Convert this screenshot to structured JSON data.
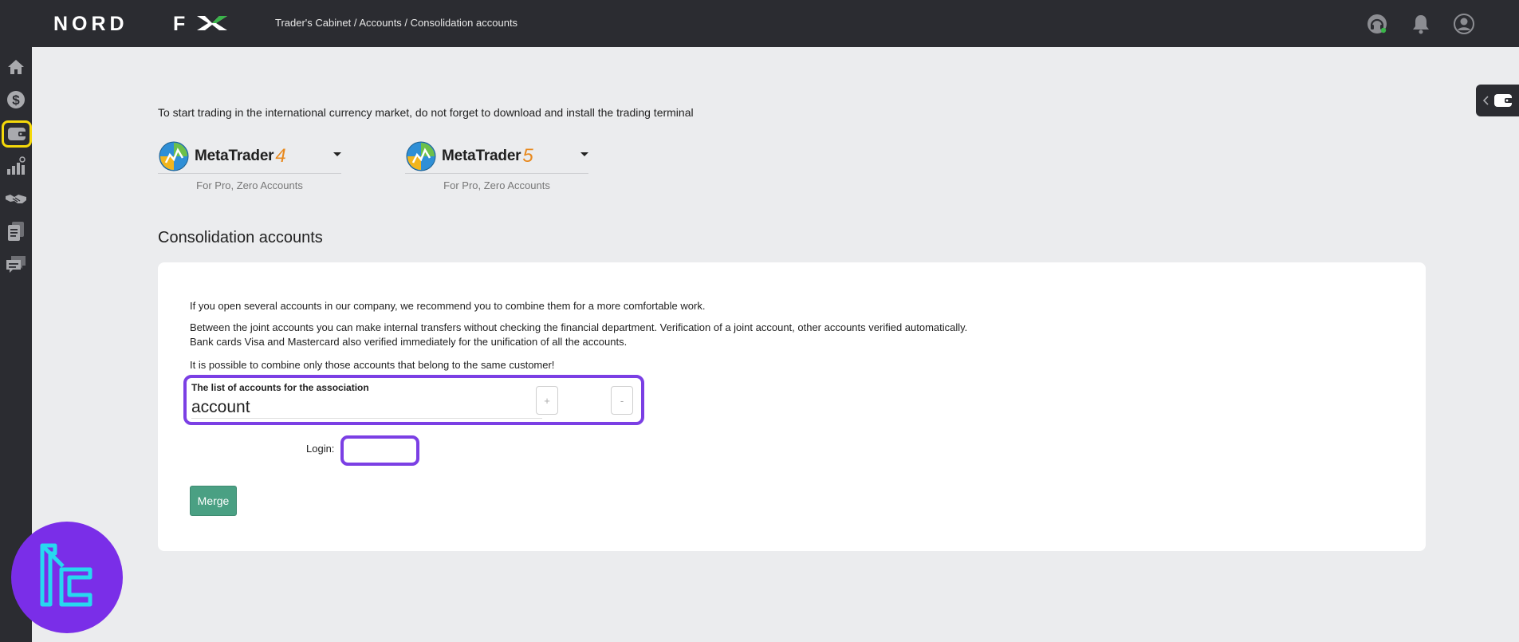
{
  "header": {
    "logo_text": "NORD FX",
    "breadcrumb": "Trader's Cabinet / Accounts / Consolidation accounts",
    "icons": [
      "headset-icon",
      "bell-icon",
      "user-icon"
    ]
  },
  "sidebar": {
    "items": [
      {
        "icon": "home-icon"
      },
      {
        "icon": "dollar-icon"
      },
      {
        "icon": "wallet-icon",
        "active": true
      },
      {
        "icon": "chart-icon"
      },
      {
        "icon": "handshake-icon"
      },
      {
        "icon": "documents-icon"
      },
      {
        "icon": "chat-icon"
      }
    ]
  },
  "wallet_panel": {
    "icon": "wallet-icon",
    "toggle_icon": "chevron-left-icon"
  },
  "main": {
    "intro": "To start trading in the international currency market, do not forget to download and install the trading terminal",
    "terminals": [
      {
        "name": "MetaTrader",
        "version": "4",
        "subtitle": "For Pro, Zero Accounts"
      },
      {
        "name": "MetaTrader",
        "version": "5",
        "subtitle": "For Pro, Zero Accounts"
      }
    ],
    "section_title": "Consolidation accounts",
    "paragraphs": {
      "p1": "If you open several accounts in our company, we recommend you to combine them for a more comfortable work.",
      "p2a": "Between the joint accounts you can make internal transfers without checking the financial department. Verification of a joint account, other accounts verified automatically.",
      "p2b": "Bank cards Visa and Mastercard also verified immediately for the unification of all the accounts.",
      "p3": "It is possible to combine only those accounts that belong to the same customer!"
    },
    "association": {
      "label": "The list of accounts for the association",
      "value": "account",
      "add_label": "+",
      "remove_label": "-"
    },
    "login": {
      "label": "Login:",
      "value": ""
    },
    "merge_label": "Merge"
  },
  "colors": {
    "topbar": "#2b2c31",
    "highlight": "#7b3fe4",
    "active_sidebar": "#f5d90a",
    "merge_button": "#4aa083",
    "mt_version": "#e8891e"
  }
}
